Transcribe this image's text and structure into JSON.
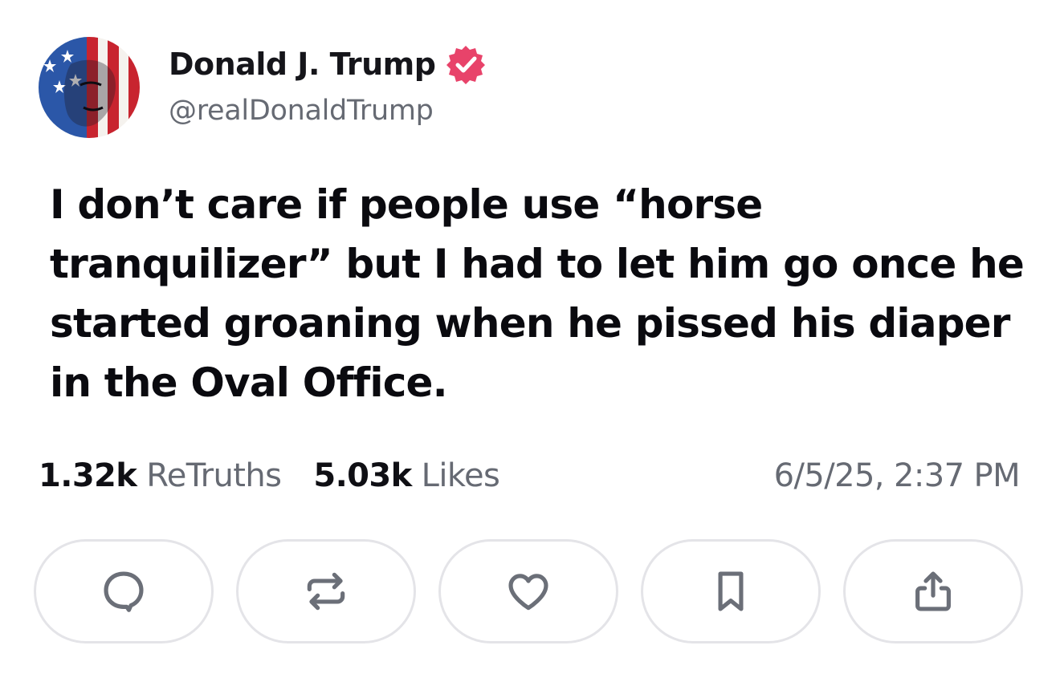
{
  "author": {
    "display_name": "Donald J. Trump",
    "handle": "@realDonaldTrump",
    "verified_color": "#e8436a"
  },
  "post": {
    "text": "I don’t care if people use “horse tranquilizer” but I had to let him go once he started groaning when he pissed his diaper in the Oval Office."
  },
  "stats": {
    "retruths_count": "1.32k",
    "retruths_label": "ReTruths",
    "likes_count": "5.03k",
    "likes_label": "Likes",
    "timestamp": "6/5/25, 2:37 PM"
  },
  "actions": [
    {
      "icon": "comment-icon"
    },
    {
      "icon": "retruth-icon"
    },
    {
      "icon": "heart-icon"
    },
    {
      "icon": "bookmark-icon"
    },
    {
      "icon": "share-icon"
    }
  ],
  "colors": {
    "icon_gray": "#6b6f78",
    "button_border": "#e4e4e8"
  }
}
